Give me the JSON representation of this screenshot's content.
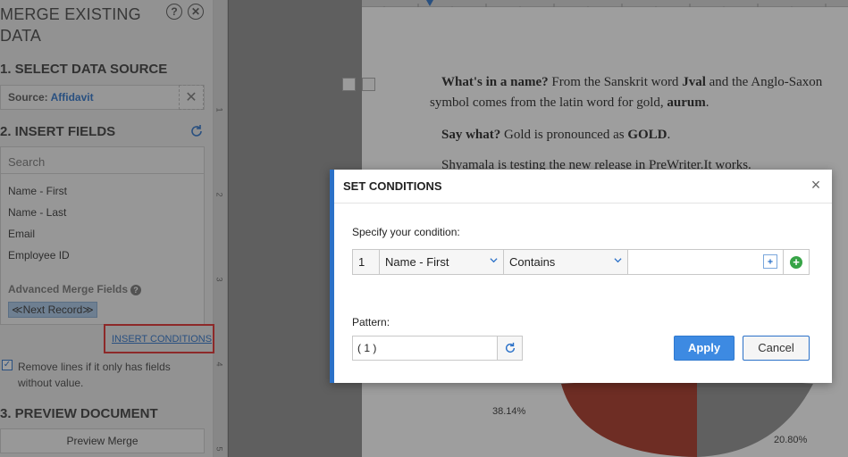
{
  "panel": {
    "title_line1": "MERGE EXISTING",
    "title_line2": "DATA",
    "help_icon": "help-icon",
    "close_icon": "close-icon",
    "section1": "1. SELECT DATA SOURCE",
    "source_label": "Source:",
    "source_value": "Affidavit",
    "section2": "2. INSERT FIELDS",
    "search_placeholder": "Search",
    "fields": [
      "Name - First",
      "Name - Last",
      "Email",
      "Employee ID"
    ],
    "advanced_label": "Advanced Merge Fields",
    "next_record": "≪Next Record≫",
    "insert_conditions": "INSERT CONDITIONS",
    "remove_lines": "Remove lines if it only has fields without value.",
    "remove_lines_checked": true,
    "section3": "3. PREVIEW DOCUMENT",
    "preview_button": "Preview Merge"
  },
  "ruler": {
    "numbers": [
      "1",
      "2",
      "3",
      "4",
      "5"
    ]
  },
  "document": {
    "p1_a": "What's in a name?",
    "p1_b": " From the Sanskrit word ",
    "p1_c": "Jval",
    "p1_d": " and the Anglo-Saxon",
    "p2_a": "symbol comes from the latin word for gold, ",
    "p2_b": "aurum",
    "p2_c": ".",
    "p3_a": "Say what?",
    "p3_b": " Gold is pronounced as ",
    "p3_c": "GOLD",
    "p3_d": ".",
    "p4": "Shyamala is testing the new release in PreWriter.It works.",
    "pie_label_1": "38.14%",
    "pie_label_2": "20.80%"
  },
  "modal": {
    "title": "SET CONDITIONS",
    "specify_label": "Specify your condition:",
    "row_number": "1",
    "field_select": "Name - First",
    "operator_select": "Contains",
    "value": "",
    "pattern_label": "Pattern:",
    "pattern_value": "( 1 )",
    "apply": "Apply",
    "cancel": "Cancel"
  },
  "colors": {
    "accent": "#2b71c8",
    "highlight_box": "#e02b2b",
    "add_green": "#37a447"
  }
}
